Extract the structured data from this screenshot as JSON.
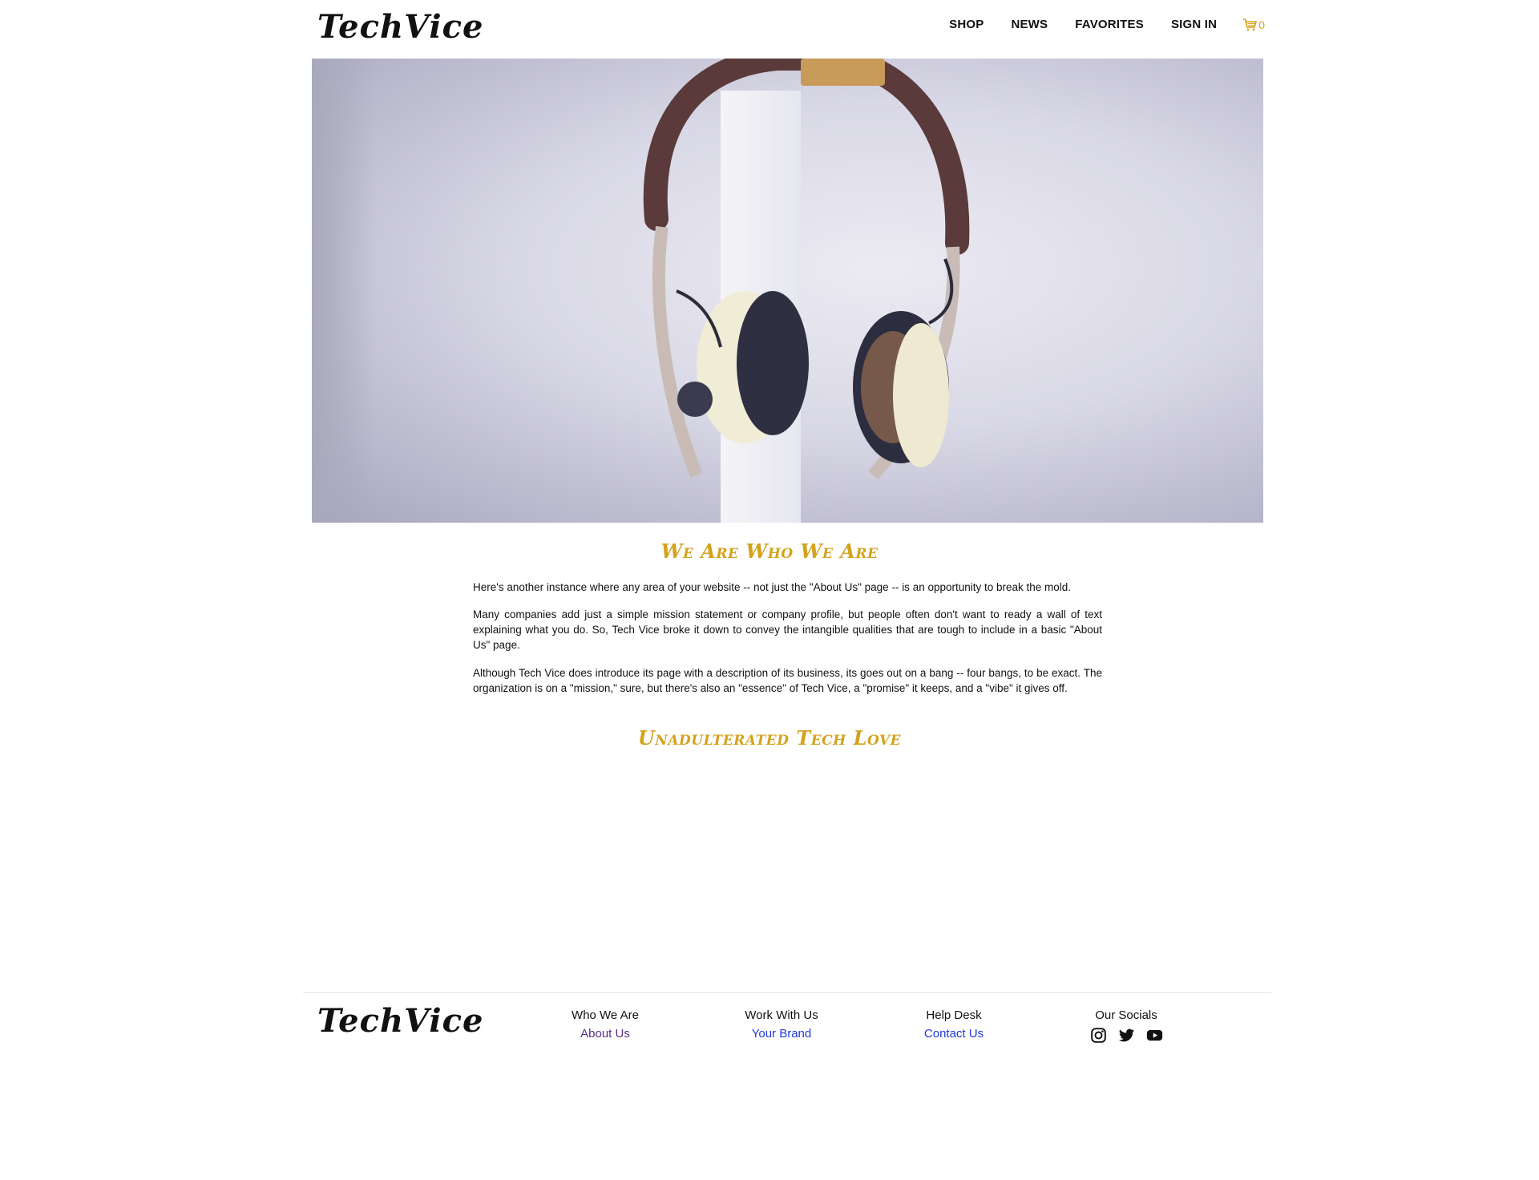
{
  "brand": {
    "logo": "TechVice"
  },
  "nav": {
    "items": [
      "SHOP",
      "NEWS",
      "FAVORITES",
      "SIGN IN"
    ],
    "cart_count": "0",
    "cart_icon": "shopping-cart-icon"
  },
  "hero": {
    "image": "headphones-photo"
  },
  "about": {
    "title": "We Are Who We Are",
    "paragraphs": [
      "Here's another instance where any area of your website -- not just the \"About Us\" page -- is an opportunity to break the mold.",
      "Many companies add just a simple mission statement or company profile, but people often don't want to ready a wall of text explaining what you do. So, Tech Vice broke it down to convey the intangible qualities that are tough to include in a basic \"About Us\" page.",
      "Although Tech Vice does introduce its page with a description of its business, its goes out on a bang -- four bangs, to be exact. The organization is on a \"mission,\" sure, but there's also an \"essence\" of Tech Vice, a \"promise\" it keeps, and a \"vibe\" it gives off."
    ],
    "subtitle": "Unadulterated Tech Love"
  },
  "footer": {
    "logo": "TechVice",
    "columns": [
      {
        "heading": "Who We Are",
        "link": "About Us"
      },
      {
        "heading": "Work With Us",
        "link": "Your Brand"
      },
      {
        "heading": "Help Desk",
        "link": "Contact Us"
      },
      {
        "heading": "Our Socials",
        "icons": [
          "instagram-icon",
          "twitter-icon",
          "youtube-icon"
        ]
      }
    ]
  },
  "colors": {
    "accent": "#d4a21d",
    "visited_link": "#5b2d86",
    "link": "#1d39d8"
  }
}
